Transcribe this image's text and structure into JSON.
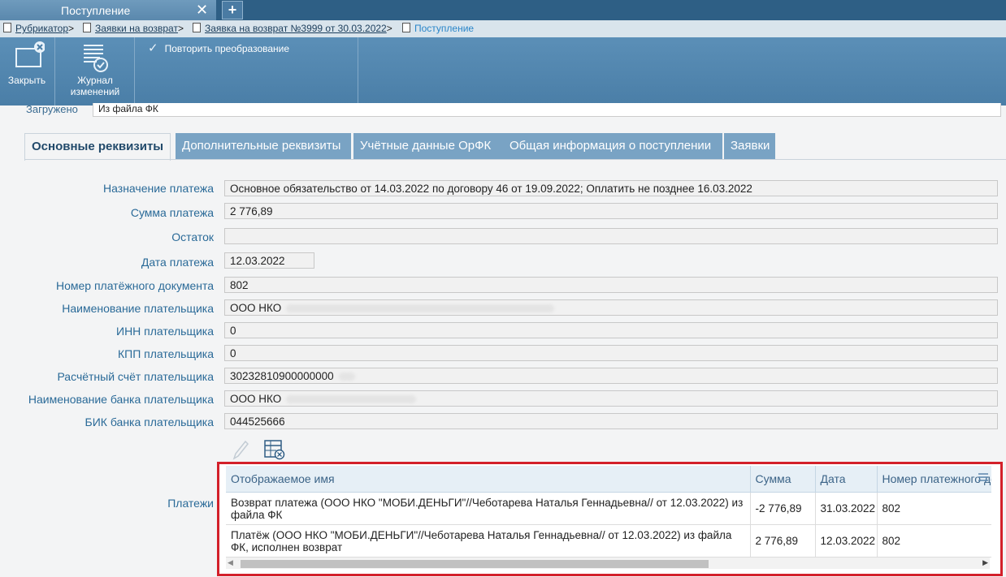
{
  "window": {
    "tab_title": "Поступление",
    "close_glyph": "✕",
    "add_glyph": "+"
  },
  "breadcrumb": {
    "items": [
      "Рубрикатор",
      "Заявки на возврат",
      "Заявка на возврат №3999 от 30.03.2022"
    ],
    "current": "Поступление",
    "separator": ">"
  },
  "toolbar": {
    "close_label": "Закрыть",
    "journal_label_1": "Журнал",
    "journal_label_2": "изменений",
    "repeat_label": "Повторить преобразование",
    "check_glyph": "✓"
  },
  "loaded": {
    "label": "Загружено",
    "value": "Из файла ФК"
  },
  "tabs": [
    "Основные реквизиты",
    "Дополнительные реквизиты",
    "Учётные данные ОрФК",
    "Общая информация о поступлении",
    "Заявки"
  ],
  "fields": {
    "purpose": {
      "label": "Назначение платежа",
      "value": "Основное обязательство от 14.03.2022 по договору 46     от 19.09.2022; Оплатить не позднее 16.03.2022"
    },
    "sum": {
      "label": "Сумма платежа",
      "value": "2 776,89"
    },
    "balance": {
      "label": "Остаток",
      "value": ""
    },
    "date": {
      "label": "Дата платежа",
      "value": "12.03.2022"
    },
    "docnum": {
      "label": "Номер платёжного документа",
      "value": "802"
    },
    "payer_name": {
      "label": "Наименование плательщика",
      "value": "ООО НКО"
    },
    "inn": {
      "label": "ИНН плательщика",
      "value": "0"
    },
    "kpp": {
      "label": "КПП плательщика",
      "value": "0"
    },
    "account": {
      "label": "Расчётный счёт плательщика",
      "value": "30232810900000000"
    },
    "bank": {
      "label": "Наименование банка плательщика",
      "value": "ООО НКО"
    },
    "bik": {
      "label": "БИК банка плательщика",
      "value": "044525666"
    }
  },
  "payments": {
    "label": "Платежи",
    "columns": [
      "Отображаемое имя",
      "Сумма",
      "Дата",
      "Номер платежного до"
    ],
    "rows": [
      {
        "name": "Возврат платежа (ООО НКО \"МОБИ.ДЕНЬГИ\"//Чеботарева Наталья Геннадьевна// от 12.03.2022) из файла ФК",
        "sum": "-2 776,89",
        "date": "31.03.2022",
        "num": "802"
      },
      {
        "name": "Платёж (ООО НКО \"МОБИ.ДЕНЬГИ\"//Чеботарева Наталья Геннадьевна// от 12.03.2022) из файла ФК, исполнен возврат",
        "sum": "2 776,89",
        "date": "12.03.2022",
        "num": "802"
      }
    ],
    "highlight_color": "#d3202a"
  }
}
